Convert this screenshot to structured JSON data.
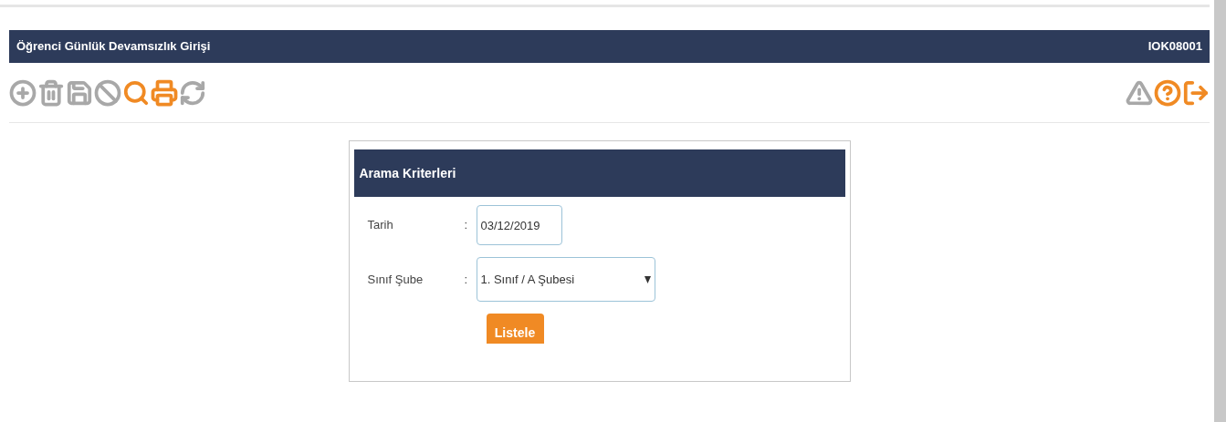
{
  "header": {
    "title": "Öğrenci Günlük Devamsızlık Girişi",
    "code": "IOK08001"
  },
  "toolbar": {
    "left": [
      {
        "kind": "add",
        "disabled": true
      },
      {
        "kind": "delete",
        "disabled": true
      },
      {
        "kind": "save",
        "disabled": true
      },
      {
        "kind": "cancel",
        "disabled": true
      },
      {
        "kind": "search",
        "disabled": false
      },
      {
        "kind": "print",
        "disabled": false
      },
      {
        "kind": "refresh",
        "disabled": true
      }
    ],
    "right": [
      {
        "kind": "warning",
        "disabled": true
      },
      {
        "kind": "help",
        "disabled": false
      },
      {
        "kind": "exit",
        "disabled": false
      }
    ]
  },
  "panel": {
    "title": "Arama Kriterleri",
    "fields": [
      {
        "kind": "text",
        "label": "Tarih",
        "separator": ":",
        "value": "03/12/2019"
      },
      {
        "kind": "select",
        "label": "Sınıf Şube",
        "separator": ":",
        "value": "1. Sınıf / A Şubesi"
      }
    ],
    "button": "Listele"
  }
}
